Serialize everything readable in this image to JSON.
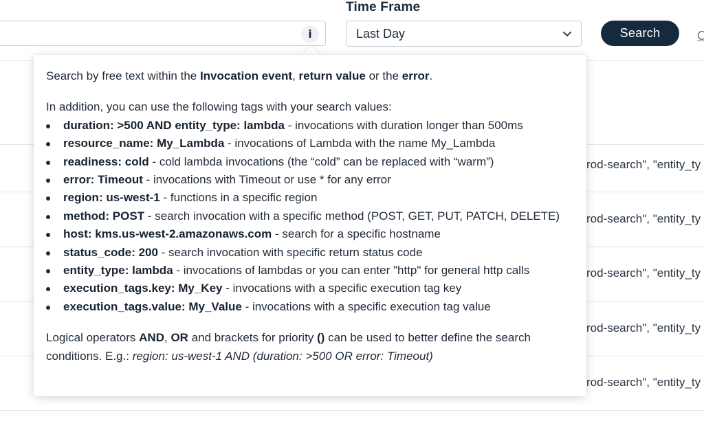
{
  "toolbar": {
    "info_icon": "i",
    "time_frame_label": "Time Frame",
    "time_frame_value": "Last Day",
    "search_label": "Search",
    "edge_link_fragment": "C"
  },
  "background_rows": [
    "rod-search\", \"entity_ty",
    "rod-search\", \"entity_ty",
    "rod-search\", \"entity_ty",
    "rod-search\", \"entity_ty",
    "rod-search\", \"entity_ty"
  ],
  "popover": {
    "intro": {
      "prefix": "Search by free text within the ",
      "invocation_event": "Invocation event",
      "sep1": ", ",
      "return_value": "return value",
      "sep2": " or the ",
      "error": "error",
      "suffix": "."
    },
    "tags_intro": "In addition, you can use the following tags with your search values:",
    "tags": [
      {
        "key": "duration: >500 AND entity_type: lambda",
        "desc": " - invocations with duration longer than 500ms"
      },
      {
        "key": "resource_name: My_Lambda",
        "desc": " - invocations of Lambda with the name My_Lambda"
      },
      {
        "key": "readiness: cold",
        "desc": " - cold lambda invocations (the “cold” can be replaced with “warm”)"
      },
      {
        "key": "error: Timeout",
        "desc": " - invocations with Timeout or use * for any error"
      },
      {
        "key": "region: us-west-1",
        "desc": " - functions in a specific region"
      },
      {
        "key": "method: POST",
        "desc": " - search invocation with a specific method (POST, GET, PUT, PATCH, DELETE)"
      },
      {
        "key": "host: kms.us-west-2.amazonaws.com",
        "desc": " - search for a specific hostname"
      },
      {
        "key": "status_code: 200",
        "desc": " - search invocation with specific return status code"
      },
      {
        "key": "entity_type: lambda",
        "desc": " - invocations of lambdas or you can enter \"http\" for general http calls"
      },
      {
        "key": "execution_tags.key: My_Key",
        "desc": " - invocations with a specific execution tag key"
      },
      {
        "key": "execution_tags.value: My_Value",
        "desc": " - invocations with a specific execution tag value"
      }
    ],
    "logic": {
      "prefix": "Logical operators ",
      "and": "AND",
      "sep1": ", ",
      "or": "OR",
      "mid": " and brackets for priority ",
      "brackets": "()",
      "tail": " can be used to better define the search conditions. E.g.: ",
      "example": "region: us-west-1 AND (duration: >500 OR error: Timeout)"
    }
  }
}
